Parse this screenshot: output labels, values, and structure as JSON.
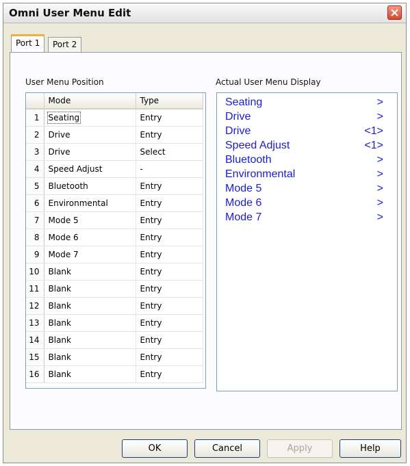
{
  "window": {
    "title": "Omni User Menu Edit"
  },
  "tabs": [
    {
      "label": "Port 1",
      "active": true
    },
    {
      "label": "Port 2",
      "active": false
    }
  ],
  "left_panel": {
    "label": "User Menu Position",
    "columns": [
      "Mode",
      "Type"
    ],
    "rows": [
      {
        "num": "1",
        "mode": "Seating",
        "type": "Entry"
      },
      {
        "num": "2",
        "mode": "Drive",
        "type": "Entry"
      },
      {
        "num": "3",
        "mode": "Drive",
        "type": "Select"
      },
      {
        "num": "4",
        "mode": "Speed Adjust",
        "type": "-"
      },
      {
        "num": "5",
        "mode": "Bluetooth",
        "type": "Entry"
      },
      {
        "num": "6",
        "mode": "Environmental",
        "type": "Entry"
      },
      {
        "num": "7",
        "mode": "Mode 5",
        "type": "Entry"
      },
      {
        "num": "8",
        "mode": "Mode 6",
        "type": "Entry"
      },
      {
        "num": "9",
        "mode": "Mode 7",
        "type": "Entry"
      },
      {
        "num": "10",
        "mode": "Blank",
        "type": "Entry"
      },
      {
        "num": "11",
        "mode": "Blank",
        "type": "Entry"
      },
      {
        "num": "12",
        "mode": "Blank",
        "type": "Entry"
      },
      {
        "num": "13",
        "mode": "Blank",
        "type": "Entry"
      },
      {
        "num": "14",
        "mode": "Blank",
        "type": "Entry"
      },
      {
        "num": "15",
        "mode": "Blank",
        "type": "Entry"
      },
      {
        "num": "16",
        "mode": "Blank",
        "type": "Entry"
      }
    ]
  },
  "right_panel": {
    "label": "Actual User Menu Display",
    "items": [
      {
        "name": "Seating",
        "indicator": ">"
      },
      {
        "name": "Drive",
        "indicator": ">"
      },
      {
        "name": "Drive",
        "indicator": "<1>"
      },
      {
        "name": "Speed Adjust",
        "indicator": "<1>"
      },
      {
        "name": "Bluetooth",
        "indicator": ">"
      },
      {
        "name": "Environmental",
        "indicator": ">"
      },
      {
        "name": "Mode 5",
        "indicator": ">"
      },
      {
        "name": "Mode 6",
        "indicator": ">"
      },
      {
        "name": "Mode 7",
        "indicator": ">"
      }
    ]
  },
  "buttons": {
    "ok": "OK",
    "cancel": "Cancel",
    "apply": "Apply",
    "help": "Help"
  },
  "colors": {
    "display_text": "#1a1ad8",
    "close_button": "#d4482f",
    "tab_highlight": "#f0b040"
  }
}
